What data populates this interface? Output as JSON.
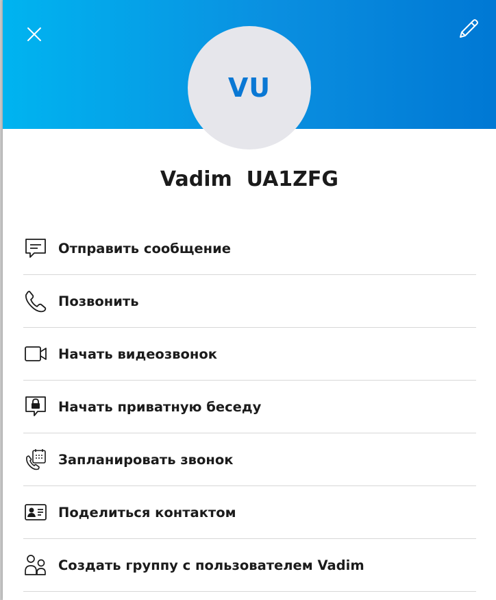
{
  "contact": {
    "initials": "VU",
    "display_name": "Vadim  UA1ZFG"
  },
  "header": {
    "close_icon": "close-icon",
    "edit_icon": "pencil-icon"
  },
  "actions": [
    {
      "icon": "message-icon",
      "label": "Отправить сообщение"
    },
    {
      "icon": "phone-icon",
      "label": "Позвонить"
    },
    {
      "icon": "video-camera-icon",
      "label": "Начать видеозвонок"
    },
    {
      "icon": "private-chat-lock-icon",
      "label": "Начать приватную беседу"
    },
    {
      "icon": "schedule-call-icon",
      "label": "Запланировать звонок"
    },
    {
      "icon": "contact-card-icon",
      "label": "Поделиться контактом"
    },
    {
      "icon": "create-group-icon",
      "label": "Создать группу с пользователем Vadim"
    }
  ],
  "colors": {
    "header_gradient_start": "#00b4f0",
    "header_gradient_end": "#0078d4",
    "avatar_bg": "#e6e6eb",
    "avatar_text": "#0a78d4",
    "text": "#1b1b1b",
    "divider": "#d7d7d7"
  }
}
